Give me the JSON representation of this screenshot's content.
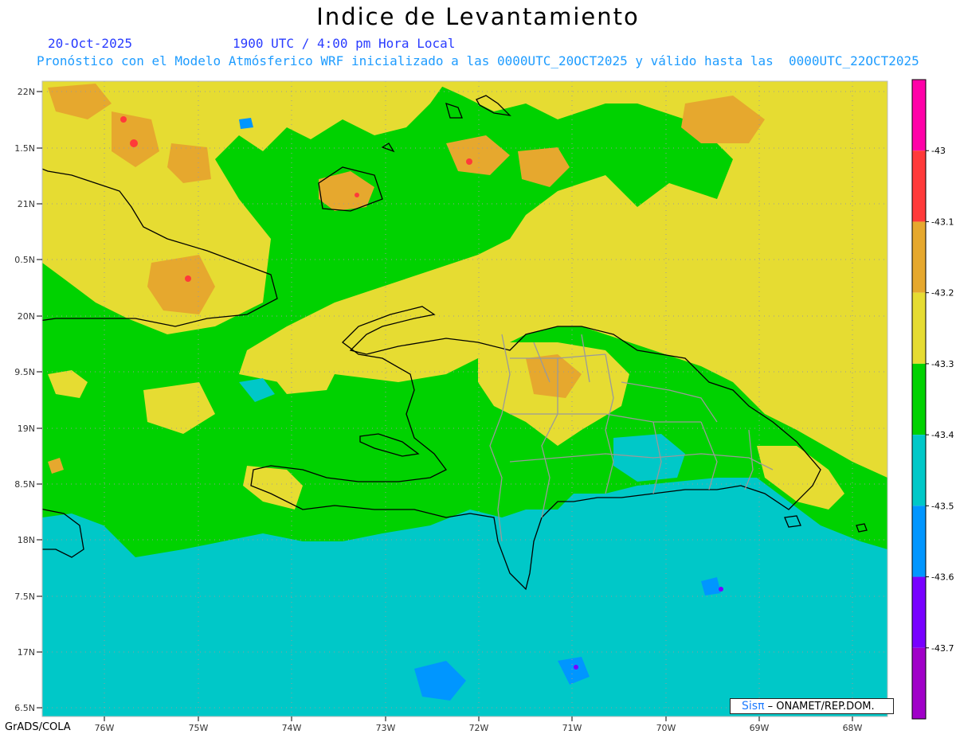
{
  "title": "Indice de Levantamiento",
  "date": "20-Oct-2025",
  "time": "1900 UTC / 4:00 pm Hora Local",
  "forecast_note": "Pronóstico con el Modelo Atmósferico WRF inicializado a las 0000UTC_20OCT2025 y válido hasta las  0000UTC_22OCT2025",
  "lat_labels": [
    "22N",
    "1.5N",
    "21N",
    "0.5N",
    "20N",
    "9.5N",
    "19N",
    "8.5N",
    "18N",
    "7.5N",
    "17N",
    "6.5N"
  ],
  "lon_labels": [
    "76W",
    "75W",
    "74W",
    "73W",
    "72W",
    "71W",
    "70W",
    "69W",
    "68W"
  ],
  "colorbar": {
    "colors": [
      "#ff00a8",
      "#ff3a3a",
      "#e6a82e",
      "#e6dc32",
      "#00d200",
      "#00c8c8",
      "#0096ff",
      "#7800ff",
      "#a000c8"
    ],
    "labels": [
      "-43",
      "-43.1",
      "-43.2",
      "-43.3",
      "-43.4",
      "-43.5",
      "-43.6",
      "-43.7"
    ]
  },
  "credit": {
    "logo": "Sisπ",
    "text": "– ONAMET/REP.DOM."
  },
  "footer": "GrADS/COLA"
}
